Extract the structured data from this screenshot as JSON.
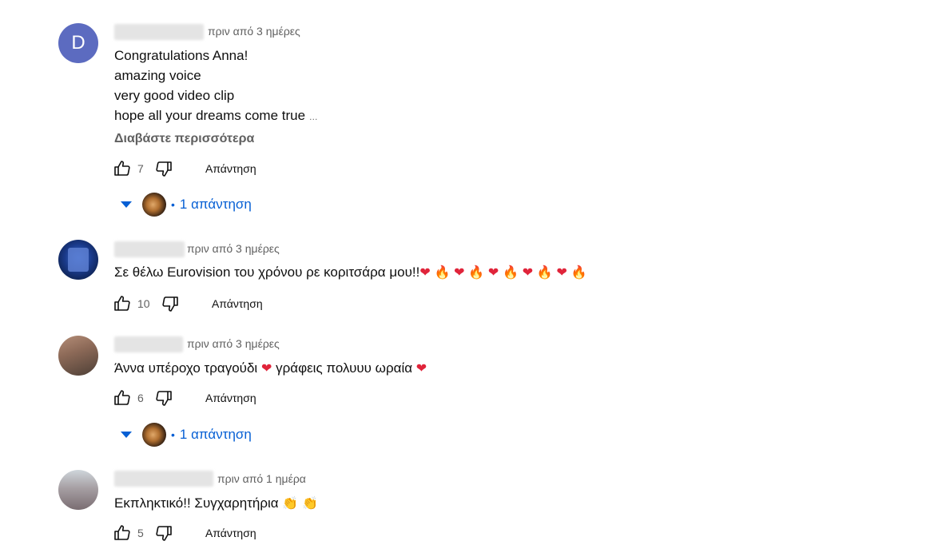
{
  "comments": [
    {
      "avatar_letter": "D",
      "time": "πριν από 3 ημέρες",
      "text": "Congratulations Anna!\namazing voice\nvery good video clip\nhope all your dreams come true ",
      "ellipsis": "…",
      "read_more": "Διαβάστε περισσότερα",
      "likes": "7",
      "reply_label": "Απάντηση",
      "replies_label": "1 απάντηση"
    },
    {
      "time": "πριν από 3 ημέρες",
      "text": "Σε θέλω Eurovision του χρόνου ρε κοριτσάρα μου!!",
      "likes": "10",
      "reply_label": "Απάντηση"
    },
    {
      "time": "πριν από 3 ημέρες",
      "text_a": "Άννα υπέροχο τραγούδι ",
      "text_b": " γράφεις πολυυυ ωραία ",
      "likes": "6",
      "reply_label": "Απάντηση",
      "replies_label": "1 απάντηση"
    },
    {
      "time": "πριν από 1 ημέρα",
      "text": "Εκπληκτικό!! Συγχαρητήρια ",
      "likes": "5",
      "reply_label": "Απάντηση"
    }
  ],
  "emoji": {
    "heart": "❤",
    "fire": "🔥",
    "clap": "👏"
  },
  "colors": {
    "link_blue": "#065fd4",
    "meta_grey": "#606060",
    "avatar_d": "#5c6bc0"
  }
}
